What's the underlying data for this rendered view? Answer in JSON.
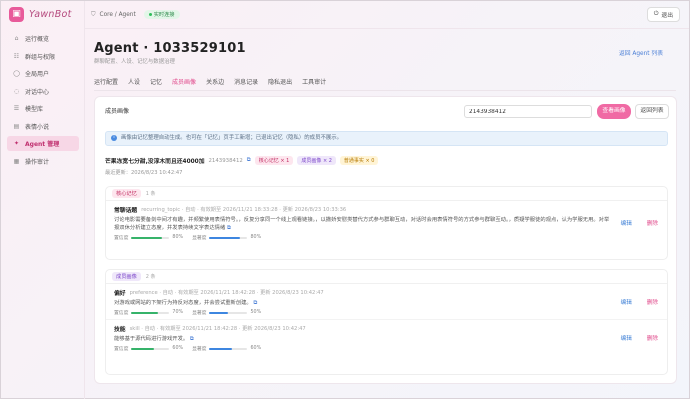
{
  "app": {
    "logo_text": "YawnBot"
  },
  "sidebar": {
    "items": [
      {
        "label": "运行概览",
        "icon": "home-icon"
      },
      {
        "label": "群组与权限",
        "icon": "users-icon"
      },
      {
        "label": "全局用户",
        "icon": "user-icon"
      },
      {
        "label": "对话中心",
        "icon": "chat-icon"
      },
      {
        "label": "模型库",
        "icon": "database-icon"
      },
      {
        "label": "表情小说",
        "icon": "book-icon"
      },
      {
        "label": "Agent 管理",
        "icon": "agent-icon",
        "active": true
      },
      {
        "label": "操作审计",
        "icon": "audit-icon"
      }
    ]
  },
  "topbar": {
    "breadcrumb": "Core / Agent",
    "live_label": "实时连接",
    "logout_label": "退出"
  },
  "header": {
    "title": "Agent · 1033529101",
    "subtitle": "群聊配置、人设、记忆与数据治理",
    "back_link": "返回 Agent 列表"
  },
  "tabs": [
    {
      "label": "运行配置"
    },
    {
      "label": "人设"
    },
    {
      "label": "记忆"
    },
    {
      "label": "成员画像",
      "active": true
    },
    {
      "label": "关系边"
    },
    {
      "label": "消息记录"
    },
    {
      "label": "隐私退出"
    },
    {
      "label": "工具审计"
    }
  ],
  "card": {
    "title": "成员画像",
    "search_value": "2143938412",
    "query_button": "查看画像",
    "back_button": "返回列表",
    "info": "画像由记忆整理自动生成。也可在「记忆」页手工新增；已退出记忆（隐私）的成员不展示。",
    "member": {
      "name": "芒果冻宽七分甜,没淳木而且还4000加",
      "id": "2143938412",
      "copy_icon": "⧉",
      "badges": {
        "core": "核心记忆 × 1",
        "persona": "成员画像 × 2",
        "fact": "普通事实 × 0"
      },
      "updated": "最近更新：2026/8/23 10:42:47"
    },
    "sections": [
      {
        "tag": "核心记忆",
        "count": "1 条",
        "items": [
          {
            "key": "常聊话题",
            "meta": "recurring_topic · 自动 · 有效期至 2026/11/21 18:33:28 · 更新 2026/8/23 10:33:36",
            "body": "讨论电影需要备剑中间才有趣，并频繁使用表情符号。，反复分享同一个线上观看链接。，以撒娇安慰类替代方式参与群聊互动，对话时会用表情符号的方式参与群聊互动。，质疑学服徒的观点，认为学服无用。对举报双休分析建立态度，并发表持续文字表达情绪",
            "confidence_label": "置信度",
            "confidence": "80%",
            "importance_label": "显著度",
            "importance": "80%",
            "confidence_fill": 0.8,
            "importance_fill": 0.8
          }
        ]
      },
      {
        "tag": "成员画像",
        "count": "2 条",
        "items": [
          {
            "key": "偏好",
            "meta": "preference · 自动 · 有效期至 2026/11/21 18:42:28 · 更新 2026/8/23 10:42:47",
            "body": "对游戏或网站的下架行为持反对态度，并会尝试重新创建。",
            "confidence_label": "置信度",
            "confidence": "70%",
            "importance_label": "显著度",
            "importance": "50%",
            "confidence_fill": 0.7,
            "importance_fill": 0.5
          },
          {
            "key": "技能",
            "meta": "skill · 自动 · 有效期至 2026/11/21 18:42:28 · 更新 2026/8/23 10:42:47",
            "body": "能够基于源代码进行游戏开发。",
            "confidence_label": "置信度",
            "confidence": "60%",
            "importance_label": "显著度",
            "importance": "60%",
            "confidence_fill": 0.6,
            "importance_fill": 0.6
          }
        ]
      }
    ],
    "edit_label": "编辑",
    "delete_label": "删除"
  }
}
